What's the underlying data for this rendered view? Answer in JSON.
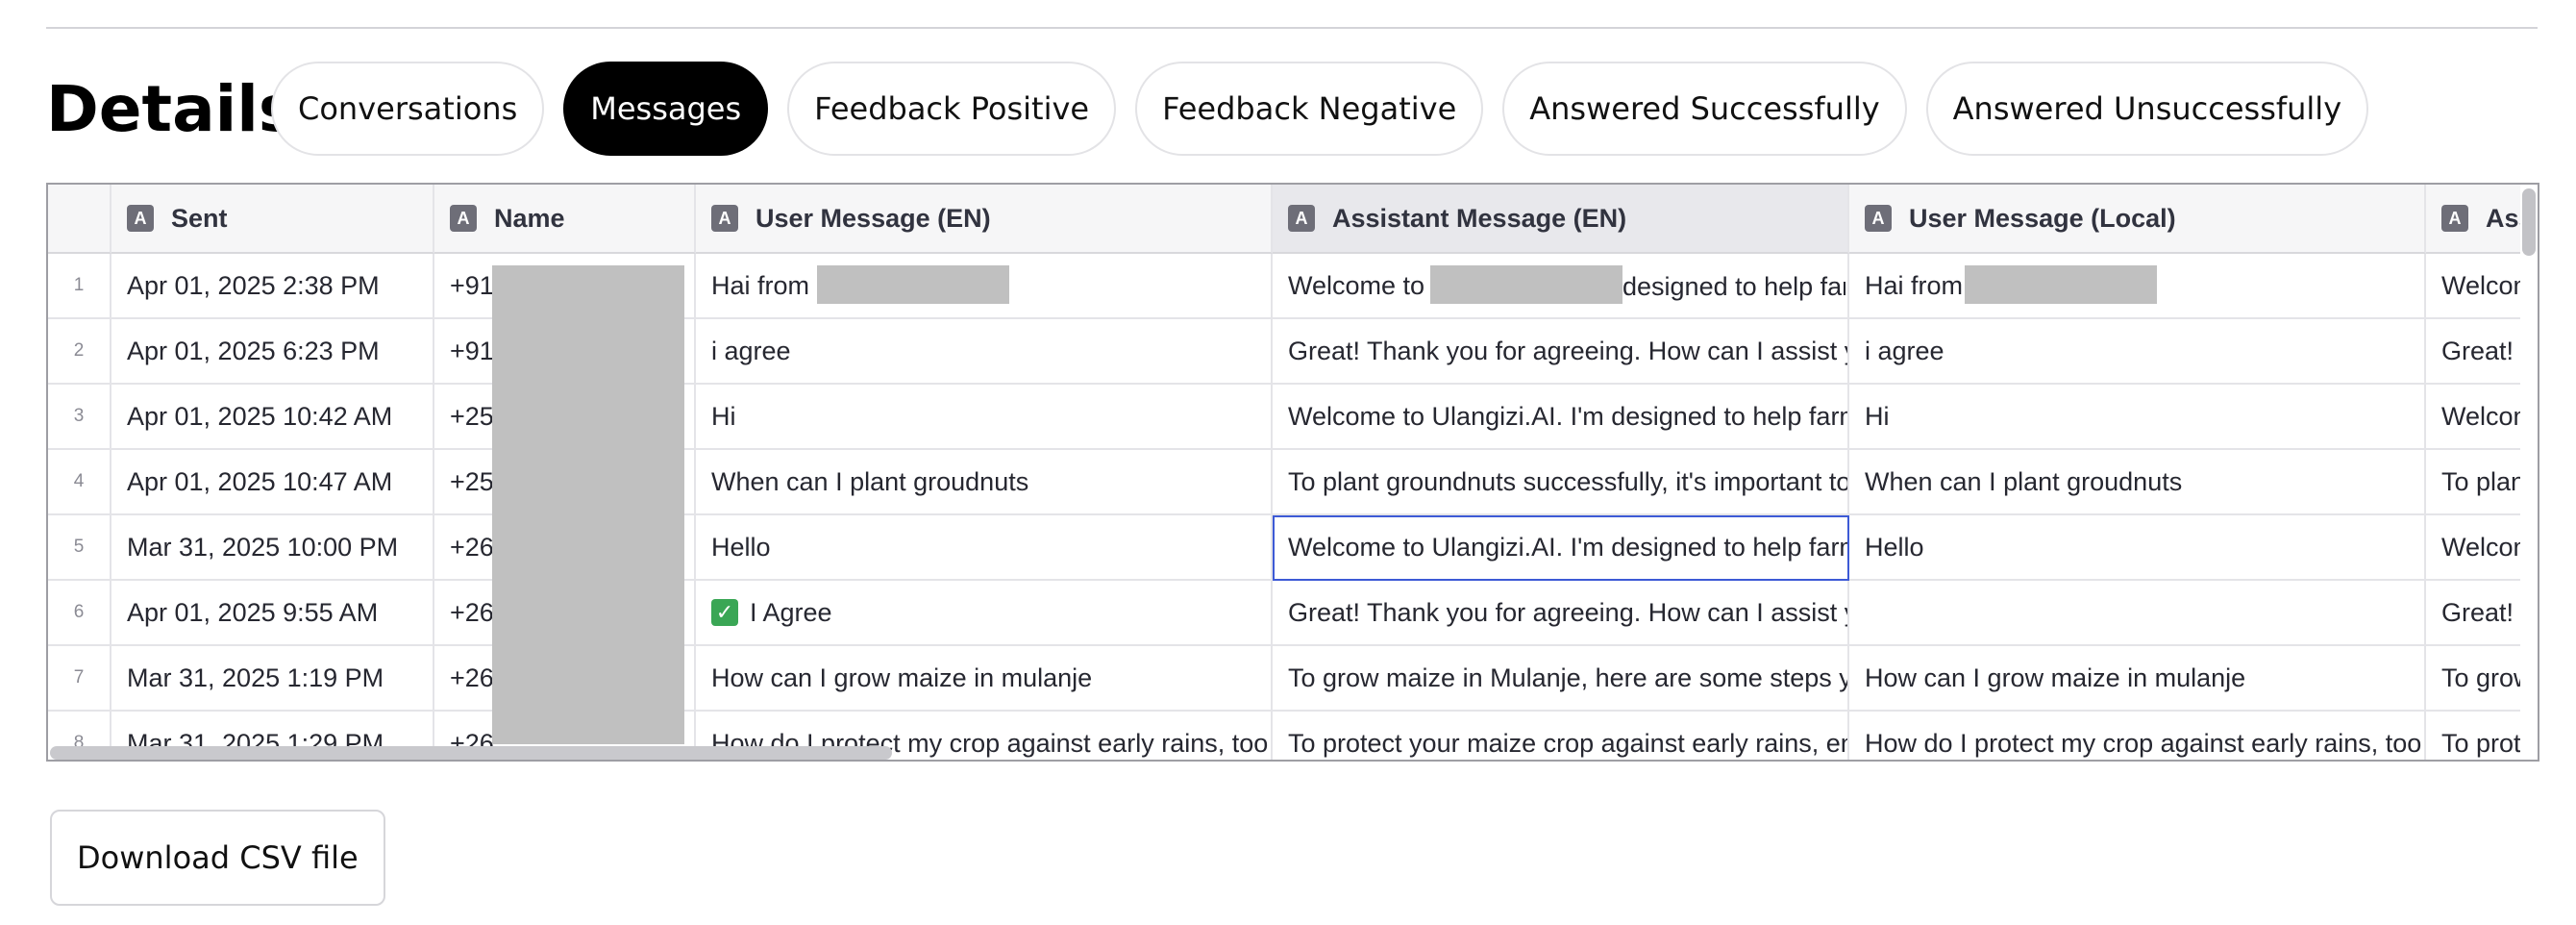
{
  "page": {
    "title": "Details"
  },
  "tabs": [
    {
      "label": "Conversations",
      "active": false
    },
    {
      "label": "Messages",
      "active": true
    },
    {
      "label": "Feedback Positive",
      "active": false
    },
    {
      "label": "Feedback Negative",
      "active": false
    },
    {
      "label": "Answered Successfully",
      "active": false
    },
    {
      "label": "Answered Unsuccessfully",
      "active": false
    }
  ],
  "table": {
    "type_badge": "A",
    "columns": [
      "Sent",
      "Name",
      "User Message (EN)",
      "Assistant Message (EN)",
      "User Message (Local)",
      "Assistant Message (Local)"
    ],
    "rows": [
      {
        "index": "1",
        "cells": [
          "Apr 01, 2025 2:38 PM",
          "+91",
          "Hai from",
          "Welcome to",
          "Hai from",
          "Welcome to"
        ],
        "assistant_tail": "designed to help farmers"
      },
      {
        "index": "2",
        "cells": [
          "Apr 01, 2025 6:23 PM",
          "+91",
          "i agree",
          "Great! Thank you for agreeing. How can I assist you today?",
          "i agree",
          "Great! Thank you for agreeing."
        ]
      },
      {
        "index": "3",
        "cells": [
          "Apr 01, 2025 10:42 AM",
          "+25",
          "Hi",
          "Welcome to Ulangizi.AI. I'm designed to help farmers",
          "Hi",
          "Welcome to Ulangizi.AI."
        ]
      },
      {
        "index": "4",
        "cells": [
          "Apr 01, 2025 10:47 AM",
          "+25",
          "When can I plant groudnuts",
          "To plant groundnuts successfully, it's important to",
          "When can I plant groudnuts",
          "To plant groundnuts"
        ]
      },
      {
        "index": "5",
        "cells": [
          "Mar 31, 2025 10:00 PM",
          "+26",
          "Hello",
          "Welcome to Ulangizi.AI. I'm designed to help farmers",
          "Hello",
          "Welcome to Ulangizi.AI."
        ]
      },
      {
        "index": "6",
        "cells": [
          "Apr 01, 2025 9:55 AM",
          "+26",
          "I Agree",
          "Great! Thank you for agreeing. How can I assist you today?",
          "",
          "Great! Thank you"
        ]
      },
      {
        "index": "7",
        "cells": [
          "Mar 31, 2025 1:19 PM",
          "+26",
          "How can I grow maize in mulanje",
          "To grow maize in Mulanje, here are some steps you can",
          "How can I grow maize in mulanje",
          "To grow maize"
        ]
      },
      {
        "index": "8",
        "cells": [
          "Mar 31, 2025 1:29 PM",
          "+26",
          "How do I protect my crop against early rains, too",
          "To protect your maize crop against early rains, ensure",
          "How do I protect my crop against early rains, too",
          "To protect"
        ]
      }
    ],
    "focused_cell": {
      "row": 5,
      "column": "Assistant Message (EN)"
    }
  },
  "actions": {
    "download_label": "Download CSV file"
  },
  "colors": {
    "accent_focus": "#3d5ad6",
    "active_tab_bg": "#000000",
    "redaction": "#c0c0c0"
  }
}
